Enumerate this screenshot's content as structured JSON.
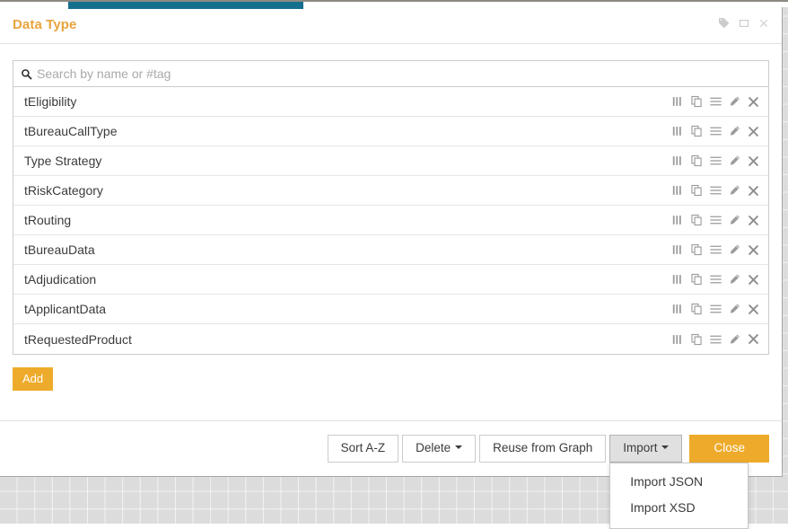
{
  "window": {
    "title": "Data Type",
    "header_icons": [
      {
        "name": "tag-icon",
        "glyph": "🏷"
      },
      {
        "name": "restore-window-icon",
        "glyph": "▭"
      },
      {
        "name": "close-window-icon",
        "glyph": "✕"
      }
    ]
  },
  "search": {
    "placeholder": "Search by name or #tag",
    "value": ""
  },
  "list": {
    "row_actions": [
      {
        "name": "columns-icon",
        "title": "Columns"
      },
      {
        "name": "duplicate-icon",
        "title": "Duplicate"
      },
      {
        "name": "menu-icon",
        "title": "Menu"
      },
      {
        "name": "edit-pencil-icon",
        "title": "Edit"
      },
      {
        "name": "delete-close-icon",
        "title": "Delete"
      }
    ],
    "items": [
      {
        "label": "tEligibility"
      },
      {
        "label": "tBureauCallType"
      },
      {
        "label": "Type Strategy"
      },
      {
        "label": "tRiskCategory"
      },
      {
        "label": "tRouting"
      },
      {
        "label": "tBureauData"
      },
      {
        "label": "tAdjudication"
      },
      {
        "label": "tApplicantData"
      },
      {
        "label": "tRequestedProduct"
      }
    ]
  },
  "actions": {
    "add_label": "Add"
  },
  "footer": {
    "sort_label": "Sort A-Z",
    "delete_label": "Delete",
    "reuse_label": "Reuse from Graph",
    "import_label": "Import",
    "close_label": "Close"
  },
  "import_menu": {
    "open": true,
    "items": [
      {
        "label": "Import JSON"
      },
      {
        "label": "Import XSD"
      }
    ]
  },
  "colors": {
    "accent_orange": "#eeab2b",
    "tab_teal": "#15708f",
    "text_dark": "#3b3b3b",
    "icon_gray": "#9b9b9b",
    "canvas_gray": "#dcdcdc"
  }
}
